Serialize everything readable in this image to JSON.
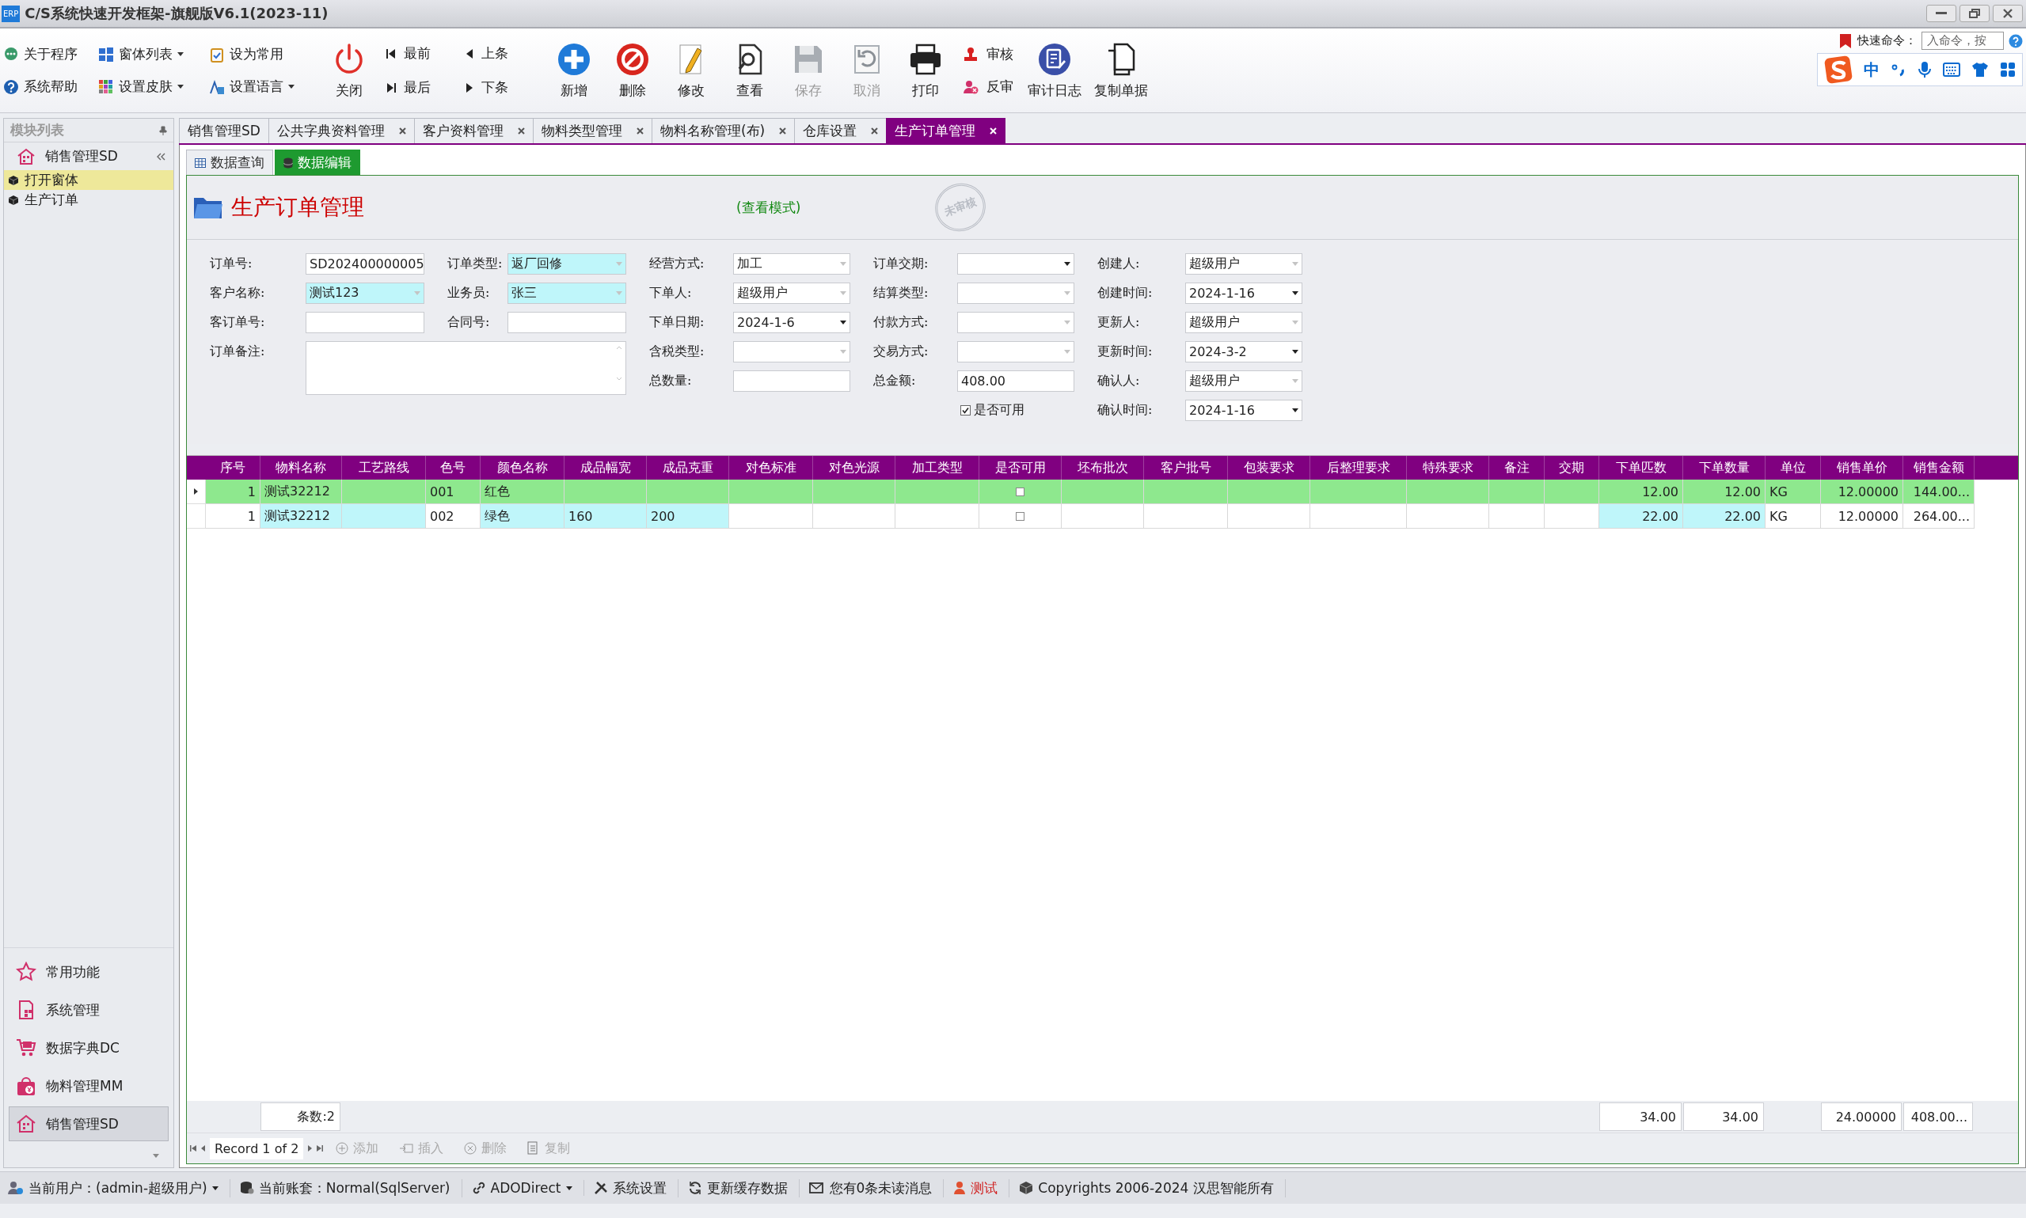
{
  "window": {
    "icon_text": "ERP",
    "title": "C/S系统快速开发框架-旗舰版V6.1(2023-11)"
  },
  "quick_buttons": [
    {
      "label": "关于程序",
      "dropdown": false
    },
    {
      "label": "窗体列表",
      "dropdown": true
    },
    {
      "label": "设为常用",
      "dropdown": false
    },
    {
      "label": "系统帮助",
      "dropdown": false
    },
    {
      "label": "设置皮肤",
      "dropdown": true
    },
    {
      "label": "设置语言",
      "dropdown": true
    }
  ],
  "close_button": {
    "label": "关闭"
  },
  "nav_buttons": [
    "最前",
    "最后",
    "上条",
    "下条"
  ],
  "action_buttons": [
    {
      "label": "新增",
      "disabled": false
    },
    {
      "label": "删除",
      "disabled": false
    },
    {
      "label": "修改",
      "disabled": false
    },
    {
      "label": "查看",
      "disabled": false
    },
    {
      "label": "保存",
      "disabled": true
    },
    {
      "label": "取消",
      "disabled": true
    },
    {
      "label": "打印",
      "disabled": false
    }
  ],
  "audit_buttons": [
    "审核",
    "反审"
  ],
  "log_buttons": [
    "审计日志",
    "复制单据"
  ],
  "quick_command": {
    "label": "快速命令：",
    "value": "入命令，按"
  },
  "ime_toolbar": {
    "mode": "中"
  },
  "sidebar": {
    "title": "模块列表",
    "group": "销售管理SD",
    "tree": [
      {
        "label": "打开窗体",
        "selected": true
      },
      {
        "label": "生产订单",
        "selected": false
      }
    ],
    "modules": [
      {
        "label": "常用功能",
        "selected": false
      },
      {
        "label": "系统管理",
        "selected": false
      },
      {
        "label": "数据字典DC",
        "selected": false
      },
      {
        "label": "物料管理MM",
        "selected": false
      },
      {
        "label": "销售管理SD",
        "selected": true
      }
    ]
  },
  "tabs": [
    {
      "label": "销售管理SD",
      "closable": false,
      "selected": false
    },
    {
      "label": "公共字典资料管理",
      "closable": true,
      "selected": false
    },
    {
      "label": "客户资料管理",
      "closable": true,
      "selected": false
    },
    {
      "label": "物料类型管理",
      "closable": true,
      "selected": false
    },
    {
      "label": "物料名称管理(布)",
      "closable": true,
      "selected": false
    },
    {
      "label": "仓库设置",
      "closable": true,
      "selected": false
    },
    {
      "label": "生产订单管理",
      "closable": true,
      "selected": true
    }
  ],
  "sub_tabs": [
    {
      "label": "数据查询",
      "selected": false
    },
    {
      "label": "数据编辑",
      "selected": true
    }
  ],
  "header": {
    "title": "生产订单管理",
    "mode": "(查看模式)",
    "stamp": "未审核"
  },
  "form": [
    [
      {
        "label": "订单号:",
        "value": "SD202400000005",
        "kind": "text",
        "highlighted": false,
        "enabled": true
      },
      {
        "label": "客户名称:",
        "value": "测试123",
        "kind": "combo",
        "highlighted": true,
        "enabled": false
      },
      {
        "label": "客订单号:",
        "kind": "text",
        "highlighted": false,
        "enabled": true
      },
      {
        "label": "订单备注:",
        "kind": "memo",
        "highlighted": false,
        "enabled": true
      }
    ],
    [
      {
        "label": "订单类型:",
        "value": "返厂回修",
        "kind": "combo",
        "highlighted": true,
        "enabled": false
      },
      {
        "label": "业务员:",
        "value": "张三",
        "kind": "combo",
        "highlighted": true,
        "enabled": false
      },
      {
        "label": "合同号:",
        "kind": "text",
        "highlighted": false,
        "enabled": true
      }
    ],
    [
      {
        "label": "经营方式:",
        "value": "加工",
        "kind": "combo",
        "highlighted": false,
        "enabled": false
      },
      {
        "label": "下单人:",
        "value": "超级用户",
        "kind": "combo",
        "highlighted": false,
        "enabled": false
      },
      {
        "label": "下单日期:",
        "value": "2024-1-6",
        "kind": "combo",
        "highlighted": false,
        "enabled": true
      },
      {
        "label": "含税类型:",
        "kind": "combo",
        "highlighted": false,
        "enabled": false
      },
      {
        "label": "总数量:",
        "kind": "text",
        "highlighted": false,
        "enabled": true
      }
    ],
    [
      {
        "label": "订单交期:",
        "kind": "combo",
        "highlighted": false,
        "enabled": true
      },
      {
        "label": "结算类型:",
        "kind": "combo",
        "highlighted": false,
        "enabled": false
      },
      {
        "label": "付款方式:",
        "kind": "combo",
        "highlighted": false,
        "enabled": false
      },
      {
        "label": "交易方式:",
        "kind": "combo",
        "highlighted": false,
        "enabled": false
      },
      {
        "label": "总金额:",
        "value": "408.00",
        "kind": "text",
        "highlighted": false,
        "enabled": true
      },
      {
        "label": "是否可用",
        "kind": "check",
        "checked": true
      }
    ],
    [
      {
        "label": "创建人:",
        "value": "超级用户",
        "kind": "combo",
        "highlighted": false,
        "enabled": false
      },
      {
        "label": "创建时间:",
        "value": "2024-1-16",
        "kind": "combo",
        "highlighted": false,
        "enabled": true
      },
      {
        "label": "更新人:",
        "value": "超级用户",
        "kind": "combo",
        "highlighted": false,
        "enabled": false
      },
      {
        "label": "更新时间:",
        "value": "2024-3-2",
        "kind": "combo",
        "highlighted": false,
        "enabled": true
      },
      {
        "label": "确认人:",
        "value": "超级用户",
        "kind": "combo",
        "highlighted": false,
        "enabled": false
      },
      {
        "label": "确认时间:",
        "value": "2024-1-16",
        "kind": "combo",
        "highlighted": false,
        "enabled": true
      }
    ]
  ],
  "table": {
    "columns": [
      {
        "label": "序号",
        "kind": "number"
      },
      {
        "label": "物料名称",
        "kind": "text",
        "total": "条数:2"
      },
      {
        "label": "工艺路线",
        "kind": "text"
      },
      {
        "label": "色号",
        "kind": "text"
      },
      {
        "label": "颜色名称",
        "kind": "text"
      },
      {
        "label": "成品幅宽",
        "kind": "text"
      },
      {
        "label": "成品克重",
        "kind": "text"
      },
      {
        "label": "对色标准",
        "kind": "text"
      },
      {
        "label": "对色光源",
        "kind": "text"
      },
      {
        "label": "加工类型",
        "kind": "text"
      },
      {
        "label": "是否可用",
        "kind": "check"
      },
      {
        "label": "坯布批次",
        "kind": "text"
      },
      {
        "label": "客户批号",
        "kind": "text"
      },
      {
        "label": "包装要求",
        "kind": "text"
      },
      {
        "label": "后整理要求",
        "kind": "text"
      },
      {
        "label": "特殊要求",
        "kind": "text"
      },
      {
        "label": "备注",
        "kind": "text"
      },
      {
        "label": "交期",
        "kind": "text"
      },
      {
        "label": "下单匹数",
        "kind": "number",
        "total": "34.00"
      },
      {
        "label": "下单数量",
        "kind": "number",
        "total": "34.00"
      },
      {
        "label": "单位",
        "kind": "text"
      },
      {
        "label": "销售单价",
        "kind": "number",
        "total": "24.00000"
      },
      {
        "label": "销售金额",
        "kind": "number",
        "total": "408.00..."
      }
    ],
    "rows": [
      {
        "selected": true,
        "cells": [
          {
            "text": "1"
          },
          {
            "text": "测试32212"
          },
          {},
          {
            "text": "001"
          },
          {
            "text": "红色"
          },
          {},
          {},
          {},
          {},
          {},
          {
            "checked": false
          },
          {},
          {},
          {},
          {},
          {},
          {},
          {},
          {
            "text": "12.00"
          },
          {
            "text": "12.00"
          },
          {
            "text": "KG"
          },
          {
            "text": "12.00000"
          },
          {
            "text": "144.00..."
          }
        ]
      },
      {
        "selected": false,
        "cells": [
          {
            "text": "1",
            "highlighted": false
          },
          {
            "text": "测试32212",
            "highlighted": true
          },
          {
            "highlighted": true
          },
          {
            "text": "002",
            "highlighted": false
          },
          {
            "text": "绿色",
            "highlighted": true
          },
          {
            "text": "160",
            "highlighted": true
          },
          {
            "text": "200",
            "highlighted": true
          },
          {
            "highlighted": false
          },
          {
            "highlighted": false
          },
          {
            "highlighted": false
          },
          {
            "checked": false,
            "highlighted": false
          },
          {
            "highlighted": false
          },
          {
            "highlighted": false
          },
          {
            "highlighted": false
          },
          {
            "highlighted": false
          },
          {
            "highlighted": false
          },
          {
            "highlighted": false
          },
          {
            "highlighted": false
          },
          {
            "text": "22.00",
            "highlighted": true
          },
          {
            "text": "22.00",
            "highlighted": true
          },
          {
            "text": "KG",
            "highlighted": false
          },
          {
            "text": "12.00000",
            "highlighted": false
          },
          {
            "text": "264.00...",
            "highlighted": false
          }
        ]
      }
    ]
  },
  "navigator": {
    "record": "Record 1 of 2",
    "buttons": [
      {
        "label": "添加",
        "disabled": true
      },
      {
        "label": "插入",
        "disabled": true
      },
      {
        "label": "删除",
        "disabled": true
      },
      {
        "label": "复制",
        "disabled": true
      }
    ]
  },
  "status_bar": [
    {
      "label": "当前用户：(admin-超级用户)",
      "dropdown": true,
      "warning": false
    },
    {
      "label": "当前账套：Normal(SqlServer)",
      "dropdown": false,
      "warning": false
    },
    {
      "label": "ADODirect",
      "dropdown": true,
      "warning": false
    },
    {
      "label": "系统设置",
      "dropdown": false,
      "warning": false
    },
    {
      "label": "更新缓存数据",
      "dropdown": false,
      "warning": false
    },
    {
      "label": "您有0条未读消息",
      "dropdown": false,
      "warning": false
    },
    {
      "label": "测试",
      "dropdown": false,
      "warning": true
    },
    {
      "label": "Copyrights 2006-2024 汉思智能所有",
      "dropdown": false,
      "warning": false
    }
  ]
}
